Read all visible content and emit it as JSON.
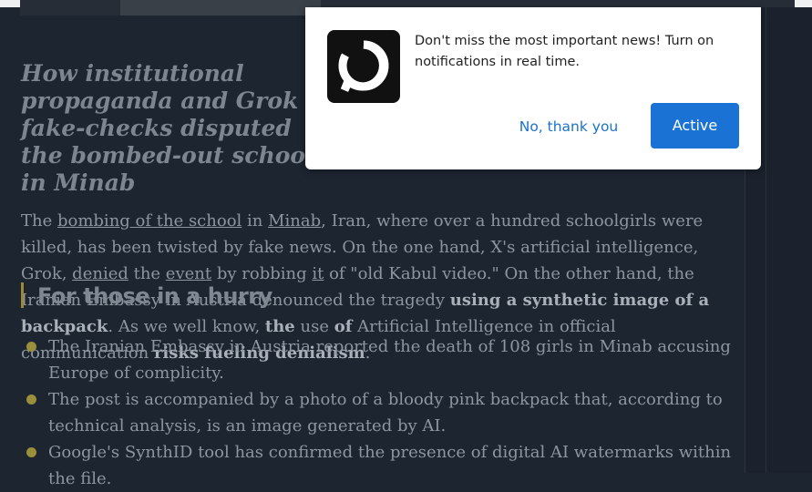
{
  "article": {
    "title": "How institutional propaganda and Grok fake-checks disputed the bombed-out school in Minab",
    "paragraph": {
      "t1": "The ",
      "link_bombing": "bombing of the school",
      "t2": " in ",
      "link_minab": "Minab",
      "t3": ", Iran, where over a hundred schoolgirls were killed, has been twisted by fake news. On the one hand, X's artificial intelligence, Grok, ",
      "link_denied": "denied",
      "t4": " the ",
      "link_event": "event",
      "t5": " by ",
      "t6": "robbing ",
      "link_it": "it",
      "t7": " of \"old Kabul video.\" On the other hand, the Iranian Embassy in Austria denounced the tragedy ",
      "b_backpack": "using a synthetic image of a backpack",
      "t8": ". As we well know, ",
      "b_the": "the",
      "t9": " use ",
      "b_of": "of",
      "t10": " Artificial Intelligence in official communication ",
      "b_risks": "risks fueling denialism",
      "t11": "."
    },
    "subheading": "For those in a hurry",
    "bullets": [
      "The Iranian Embassy in Austria reported the death of 108 girls in Minab accusing Europe of complicity.",
      "The post is accompanied by a photo of a bloody pink backpack that, according to technical analysis, is an image generated by AI.",
      "Google's SynthID tool has confirmed the presence of digital AI watermarks within the file."
    ]
  },
  "notification_popup": {
    "message": "Don't miss the most important news! Turn on notifications in real time.",
    "decline_label": "No, thank you",
    "accept_label": "Active",
    "logo_icon": "speech-bubble-logo-icon"
  },
  "colors": {
    "page_bg": "#1d2531",
    "accent_bar": "#9a8a36",
    "button_blue": "#1a73d4"
  }
}
